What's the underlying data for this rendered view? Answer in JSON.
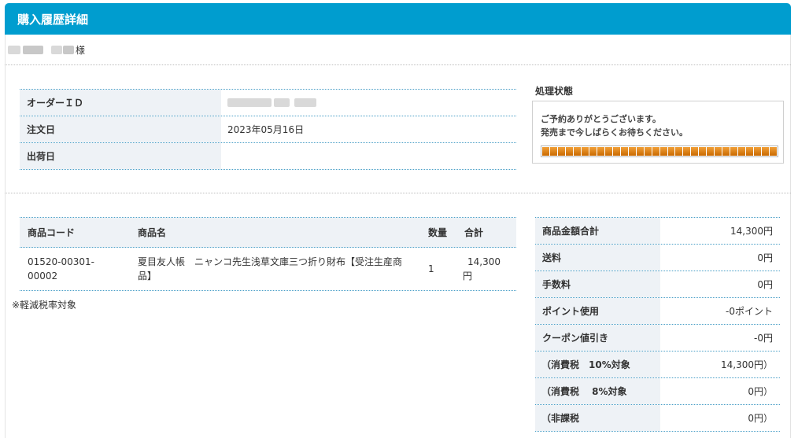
{
  "header": {
    "title": "購入履歴詳細"
  },
  "customer": {
    "suffix": "様"
  },
  "order": {
    "rows": [
      {
        "label": "オーダーＩＤ",
        "value": ""
      },
      {
        "label": "注文日",
        "value": "2023年05月16日"
      },
      {
        "label": "出荷日",
        "value": ""
      }
    ]
  },
  "status": {
    "label": "処理状態",
    "message_line1": "ご予約ありがとうございます。",
    "message_line2": "発売まで今しばらくお待ちください。",
    "progress": 1.0,
    "progress_color": "#e07f00"
  },
  "items": {
    "headers": {
      "code": "商品コード",
      "name": "商品名",
      "qty": "数量",
      "total": "合計"
    },
    "rows": [
      {
        "code_line1": "01520-00301-",
        "code_line2": "00002",
        "name_line1": "夏目友人帳　ニャンコ先生浅草文庫三つ折り財布【受注生産商",
        "name_line2": "品】",
        "qty": "1",
        "total_line1": "14,300",
        "total_line2": "円"
      }
    ]
  },
  "note": "※軽減税率対象",
  "summary": {
    "rows": [
      {
        "label": "商品金額合計",
        "value": "14,300円"
      },
      {
        "label": "送料",
        "value": "0円"
      },
      {
        "label": "手数料",
        "value": "0円"
      },
      {
        "label": "ポイント使用",
        "value": "-0ポイント"
      },
      {
        "label": "クーポン値引き",
        "value": "-0円"
      },
      {
        "label": "（消費税　10%対象",
        "value": "14,300円）"
      },
      {
        "label": "（消費税　 8%対象",
        "value": "0円）"
      },
      {
        "label": "（非課税",
        "value": "0円）"
      }
    ]
  },
  "colors": {
    "header_bg": "#009dcf",
    "table_border": "#4a9fc7",
    "label_bg": "#eef2f6"
  }
}
